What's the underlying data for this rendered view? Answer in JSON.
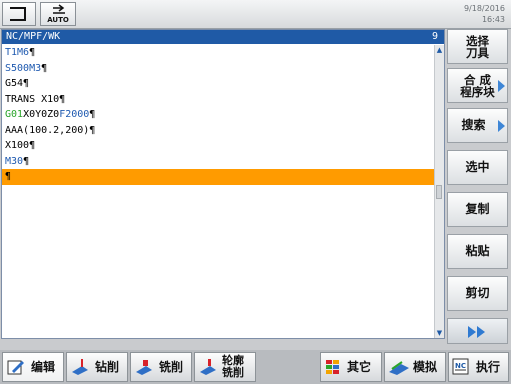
{
  "header": {
    "auto_label": "AUTO",
    "date": "9/18/2016",
    "time": "16:43"
  },
  "editor": {
    "path": "NC/MPF/WK",
    "index": "9",
    "lines": [
      {
        "segments": [
          {
            "text": "T1M6",
            "color": "blue"
          },
          {
            "text": "¶",
            "color": "black"
          }
        ]
      },
      {
        "segments": [
          {
            "text": "S500M3",
            "color": "blue"
          },
          {
            "text": "¶",
            "color": "black"
          }
        ]
      },
      {
        "segments": [
          {
            "text": "G54¶",
            "color": "black"
          }
        ]
      },
      {
        "segments": [
          {
            "text": "TRANS X10¶",
            "color": "black"
          }
        ]
      },
      {
        "segments": [
          {
            "text": "G01",
            "color": "green"
          },
          {
            "text": "X0Y0Z0",
            "color": "black"
          },
          {
            "text": "F2000",
            "color": "blue"
          },
          {
            "text": "¶",
            "color": "black"
          }
        ]
      },
      {
        "segments": [
          {
            "text": "AAA(100.2,200)¶",
            "color": "black"
          }
        ]
      },
      {
        "segments": [
          {
            "text": "X100¶",
            "color": "black"
          }
        ]
      },
      {
        "segments": [
          {
            "text": "M30",
            "color": "blue"
          },
          {
            "text": "¶",
            "color": "black"
          }
        ]
      },
      {
        "segments": [
          {
            "text": "¶",
            "color": "black"
          }
        ],
        "selected": true
      }
    ]
  },
  "vertical_softkeys": {
    "select_tool": [
      "选择",
      "刀具"
    ],
    "compile_block": [
      "合 成",
      "程序块"
    ],
    "search": "搜索",
    "select": "选中",
    "copy": "复制",
    "paste": "粘贴",
    "cut": "剪切"
  },
  "horizontal_softkeys": {
    "edit": "编辑",
    "drill": "钻削",
    "mill": "铣削",
    "contour_mill": [
      "轮廓",
      "铣削"
    ],
    "other": "其它",
    "simulate": "模拟",
    "execute": "执行"
  },
  "colors": {
    "accent": "#1f5aa6",
    "selection": "#ff9b00",
    "code_green": "#2aa52a",
    "code_blue": "#1f5ab0"
  }
}
